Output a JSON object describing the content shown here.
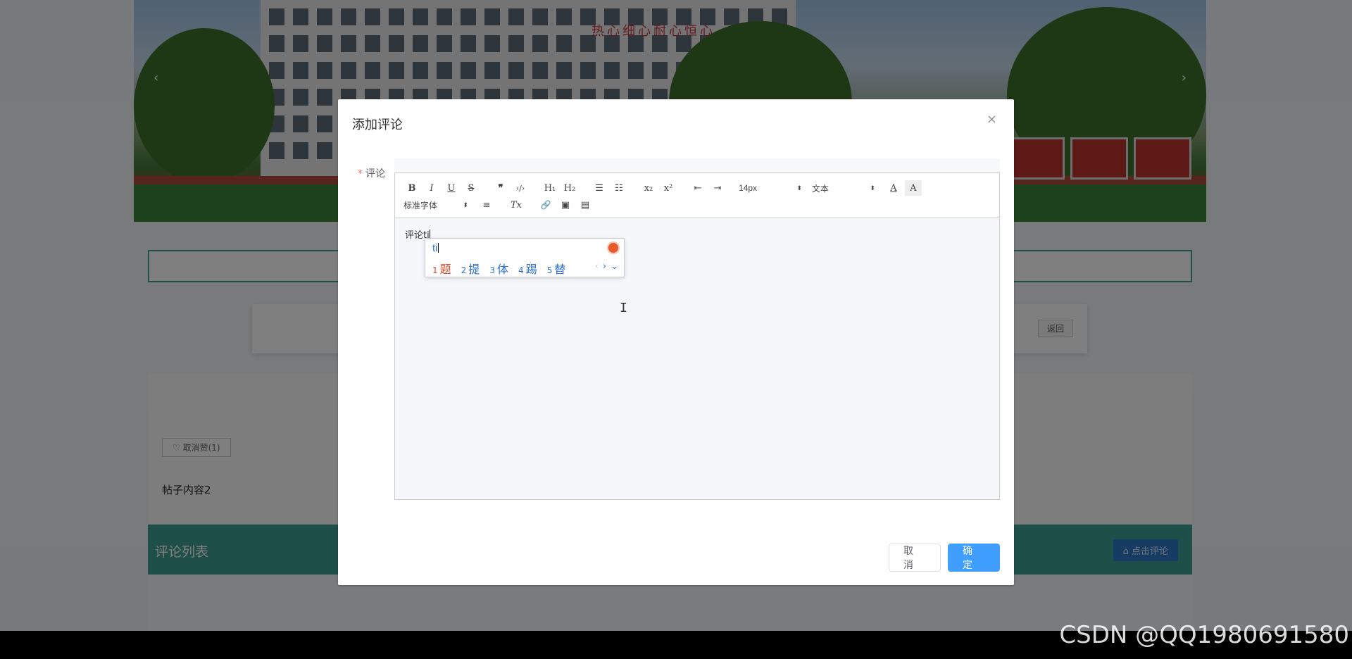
{
  "banner": {
    "slogan": "热心细心耐心恒心",
    "prev_arrow": "‹",
    "next_arrow": "›"
  },
  "page": {
    "back_button": "返回",
    "like_button": "♡ 取消赞(1)",
    "post_content": "帖子内容2",
    "comment_list_title": "评论列表",
    "comment_add_button": "⌂ 点击评论"
  },
  "dialog": {
    "title": "添加评论",
    "close_icon": "×",
    "field_required_mark": "*",
    "field_label": "评论",
    "toolbar": {
      "bold": "B",
      "italic": "I",
      "underline": "U",
      "strike": "S",
      "blockquote": "❞",
      "code": "‹/›",
      "h1": "H₁",
      "h2": "H₂",
      "ordered_list": "☰",
      "bullet_list": "☷",
      "subscript": "x₂",
      "superscript": "x²",
      "outdent": "⇤",
      "indent": "⇥",
      "font_size": "14px",
      "header_select": "文本",
      "font_color": "A",
      "background_color": "A",
      "font_family": "标准字体",
      "align": "≡",
      "clean": "Tx",
      "link": "🔗",
      "image": "▣",
      "video": "▤",
      "caret": "⬍"
    },
    "content_text": "评论ti",
    "cancel_button": "取 消",
    "ok_button": "确 定"
  },
  "ime": {
    "input": "ti",
    "candidates": [
      {
        "num": "1",
        "text": "题"
      },
      {
        "num": "2",
        "text": "提"
      },
      {
        "num": "3",
        "text": "体"
      },
      {
        "num": "4",
        "text": "踢"
      },
      {
        "num": "5",
        "text": "替"
      }
    ],
    "nav_prev": "‹",
    "nav_next": "›",
    "nav_expand": "⌄"
  },
  "cursor_glyph": "I",
  "watermark": "CSDN @QQ1980691580"
}
